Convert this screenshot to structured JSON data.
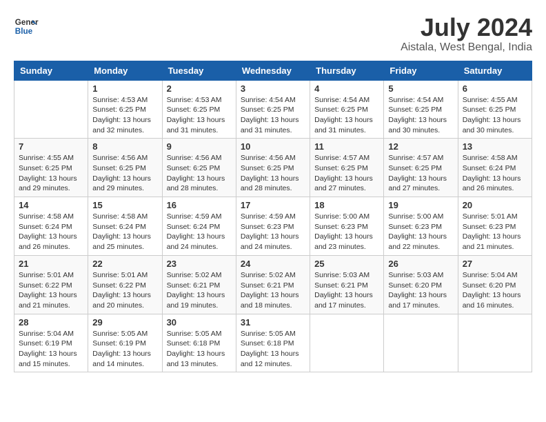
{
  "header": {
    "logo_line1": "General",
    "logo_line2": "Blue",
    "month_year": "July 2024",
    "location": "Aistala, West Bengal, India"
  },
  "days_of_week": [
    "Sunday",
    "Monday",
    "Tuesday",
    "Wednesday",
    "Thursday",
    "Friday",
    "Saturday"
  ],
  "weeks": [
    [
      {
        "num": "",
        "info": ""
      },
      {
        "num": "1",
        "info": "Sunrise: 4:53 AM\nSunset: 6:25 PM\nDaylight: 13 hours\nand 32 minutes."
      },
      {
        "num": "2",
        "info": "Sunrise: 4:53 AM\nSunset: 6:25 PM\nDaylight: 13 hours\nand 31 minutes."
      },
      {
        "num": "3",
        "info": "Sunrise: 4:54 AM\nSunset: 6:25 PM\nDaylight: 13 hours\nand 31 minutes."
      },
      {
        "num": "4",
        "info": "Sunrise: 4:54 AM\nSunset: 6:25 PM\nDaylight: 13 hours\nand 31 minutes."
      },
      {
        "num": "5",
        "info": "Sunrise: 4:54 AM\nSunset: 6:25 PM\nDaylight: 13 hours\nand 30 minutes."
      },
      {
        "num": "6",
        "info": "Sunrise: 4:55 AM\nSunset: 6:25 PM\nDaylight: 13 hours\nand 30 minutes."
      }
    ],
    [
      {
        "num": "7",
        "info": "Sunrise: 4:55 AM\nSunset: 6:25 PM\nDaylight: 13 hours\nand 29 minutes."
      },
      {
        "num": "8",
        "info": "Sunrise: 4:56 AM\nSunset: 6:25 PM\nDaylight: 13 hours\nand 29 minutes."
      },
      {
        "num": "9",
        "info": "Sunrise: 4:56 AM\nSunset: 6:25 PM\nDaylight: 13 hours\nand 28 minutes."
      },
      {
        "num": "10",
        "info": "Sunrise: 4:56 AM\nSunset: 6:25 PM\nDaylight: 13 hours\nand 28 minutes."
      },
      {
        "num": "11",
        "info": "Sunrise: 4:57 AM\nSunset: 6:25 PM\nDaylight: 13 hours\nand 27 minutes."
      },
      {
        "num": "12",
        "info": "Sunrise: 4:57 AM\nSunset: 6:25 PM\nDaylight: 13 hours\nand 27 minutes."
      },
      {
        "num": "13",
        "info": "Sunrise: 4:58 AM\nSunset: 6:24 PM\nDaylight: 13 hours\nand 26 minutes."
      }
    ],
    [
      {
        "num": "14",
        "info": "Sunrise: 4:58 AM\nSunset: 6:24 PM\nDaylight: 13 hours\nand 26 minutes."
      },
      {
        "num": "15",
        "info": "Sunrise: 4:58 AM\nSunset: 6:24 PM\nDaylight: 13 hours\nand 25 minutes."
      },
      {
        "num": "16",
        "info": "Sunrise: 4:59 AM\nSunset: 6:24 PM\nDaylight: 13 hours\nand 24 minutes."
      },
      {
        "num": "17",
        "info": "Sunrise: 4:59 AM\nSunset: 6:23 PM\nDaylight: 13 hours\nand 24 minutes."
      },
      {
        "num": "18",
        "info": "Sunrise: 5:00 AM\nSunset: 6:23 PM\nDaylight: 13 hours\nand 23 minutes."
      },
      {
        "num": "19",
        "info": "Sunrise: 5:00 AM\nSunset: 6:23 PM\nDaylight: 13 hours\nand 22 minutes."
      },
      {
        "num": "20",
        "info": "Sunrise: 5:01 AM\nSunset: 6:23 PM\nDaylight: 13 hours\nand 21 minutes."
      }
    ],
    [
      {
        "num": "21",
        "info": "Sunrise: 5:01 AM\nSunset: 6:22 PM\nDaylight: 13 hours\nand 21 minutes."
      },
      {
        "num": "22",
        "info": "Sunrise: 5:01 AM\nSunset: 6:22 PM\nDaylight: 13 hours\nand 20 minutes."
      },
      {
        "num": "23",
        "info": "Sunrise: 5:02 AM\nSunset: 6:21 PM\nDaylight: 13 hours\nand 19 minutes."
      },
      {
        "num": "24",
        "info": "Sunrise: 5:02 AM\nSunset: 6:21 PM\nDaylight: 13 hours\nand 18 minutes."
      },
      {
        "num": "25",
        "info": "Sunrise: 5:03 AM\nSunset: 6:21 PM\nDaylight: 13 hours\nand 17 minutes."
      },
      {
        "num": "26",
        "info": "Sunrise: 5:03 AM\nSunset: 6:20 PM\nDaylight: 13 hours\nand 17 minutes."
      },
      {
        "num": "27",
        "info": "Sunrise: 5:04 AM\nSunset: 6:20 PM\nDaylight: 13 hours\nand 16 minutes."
      }
    ],
    [
      {
        "num": "28",
        "info": "Sunrise: 5:04 AM\nSunset: 6:19 PM\nDaylight: 13 hours\nand 15 minutes."
      },
      {
        "num": "29",
        "info": "Sunrise: 5:05 AM\nSunset: 6:19 PM\nDaylight: 13 hours\nand 14 minutes."
      },
      {
        "num": "30",
        "info": "Sunrise: 5:05 AM\nSunset: 6:18 PM\nDaylight: 13 hours\nand 13 minutes."
      },
      {
        "num": "31",
        "info": "Sunrise: 5:05 AM\nSunset: 6:18 PM\nDaylight: 13 hours\nand 12 minutes."
      },
      {
        "num": "",
        "info": ""
      },
      {
        "num": "",
        "info": ""
      },
      {
        "num": "",
        "info": ""
      }
    ]
  ]
}
